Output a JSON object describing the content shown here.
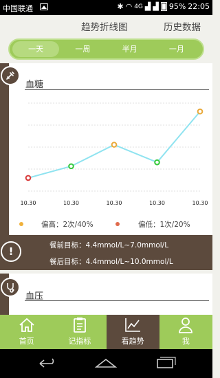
{
  "status": {
    "carrier": "中国联通",
    "network": "4G",
    "battery": "95%",
    "time": "22:05"
  },
  "header": {
    "tab_trend": "趋势折线图",
    "tab_history": "历史数据"
  },
  "periods": [
    "一天",
    "一周",
    "半月",
    "一月"
  ],
  "sugar_card": {
    "title": "血糖",
    "legend_high": "偏高：2次/40%",
    "legend_low": "偏低：1次/20%",
    "high_color": "#f0b13b",
    "low_color": "#e06a4c"
  },
  "targets": {
    "before_meal": "餐前目标：4.4mmol/L~7.0mmol/L",
    "after_meal": "餐后目标：4.4mmol/L~10.0mmol/L"
  },
  "pressure_card": {
    "title": "血压"
  },
  "nav": {
    "home": "首页",
    "record": "记指标",
    "trend": "看趋势",
    "me": "我"
  },
  "chart_data": {
    "type": "line",
    "x": [
      "10.30",
      "10.30",
      "10.30",
      "10.30",
      "10.30"
    ],
    "series": [
      {
        "values": [
          0.2,
          1.4,
          3.6,
          1.8,
          7.0
        ],
        "point_status": [
          "low",
          "normal",
          "high",
          "normal",
          "high"
        ]
      }
    ],
    "line_color": "#8fe3f0",
    "status_colors": {
      "low": "#d83a3a",
      "normal": "#36c93c",
      "high": "#e9a93a"
    },
    "ylim": [
      -1,
      8
    ],
    "grid": true,
    "legend": "bottom"
  }
}
